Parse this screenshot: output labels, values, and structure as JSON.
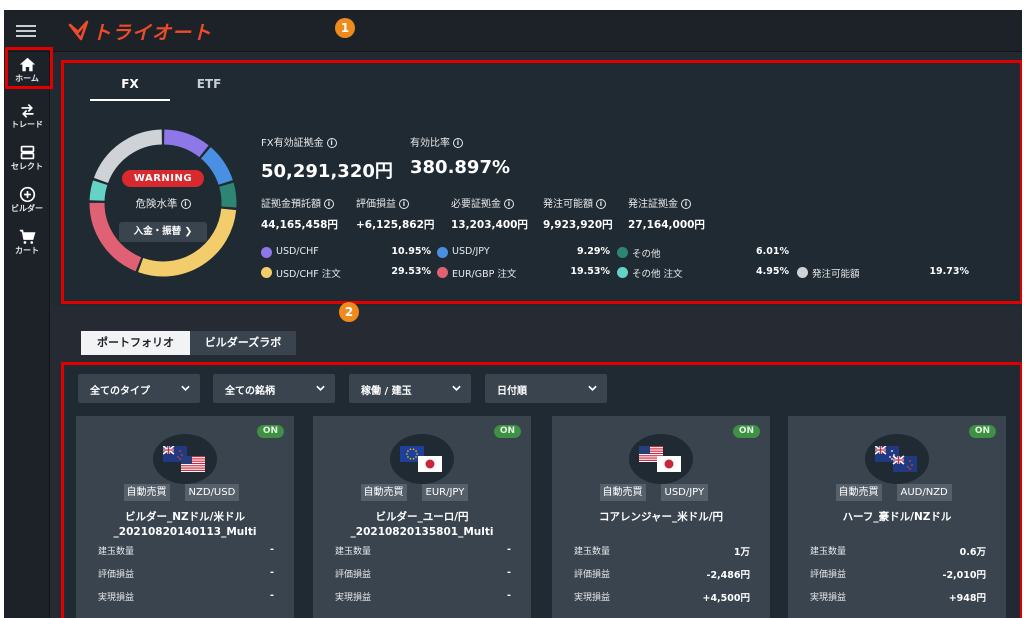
{
  "header": {
    "logo_text": "トライオート",
    "badge1": "1",
    "badge2": "2"
  },
  "sidebar": {
    "items": [
      {
        "label": "ホーム",
        "icon": "home-icon"
      },
      {
        "label": "トレード",
        "icon": "trade-arrows-icon"
      },
      {
        "label": "セレクト",
        "icon": "select-icon"
      },
      {
        "label": "ビルダー",
        "icon": "plus-circle-icon"
      },
      {
        "label": "カート",
        "icon": "cart-icon"
      }
    ]
  },
  "summary": {
    "tabs": {
      "fx": "FX",
      "etf": "ETF"
    },
    "warning": "WARNING",
    "risk_label": "危険水準",
    "deposit_button": "入金・振替",
    "fx_margin_label": "FX有効証拠金",
    "fx_margin_value": "50,291,320円",
    "ratio_label": "有効比率",
    "ratio_value": "380.897%",
    "metrics": [
      {
        "label": "証拠金預託額",
        "value": "44,165,458円"
      },
      {
        "label": "評価損益",
        "value": "+6,125,862円"
      },
      {
        "label": "必要証拠金",
        "value": "13,203,400円"
      },
      {
        "label": "発注可能額",
        "value": "9,923,920円"
      },
      {
        "label": "発注証拠金",
        "value": "27,164,000円"
      }
    ],
    "legend": [
      {
        "label": "USD/CHF",
        "pct": "10.95%",
        "color": "#8e78e8"
      },
      {
        "label": "USD/JPY",
        "pct": "9.29%",
        "color": "#4a90e2"
      },
      {
        "label": "その他",
        "pct": "6.01%",
        "color": "#2e8573"
      },
      {
        "label": "USD/CHF 注文",
        "pct": "29.53%",
        "color": "#f3cd6c"
      },
      {
        "label": "EUR/GBP 注文",
        "pct": "19.53%",
        "color": "#e06173"
      },
      {
        "label": "その他 注文",
        "pct": "4.95%",
        "color": "#64d3c6"
      },
      {
        "label": "発注可能額",
        "pct": "19.73%",
        "color": "#cfd2d6"
      }
    ]
  },
  "lower": {
    "tabs": {
      "portfolio": "ポートフォリオ",
      "builder_lab": "ビルダーズラボ"
    },
    "filters": [
      "全てのタイプ",
      "全ての銘柄",
      "稼働 / 建玉",
      "日付順"
    ],
    "row_labels": {
      "position": "建玉数量",
      "unrealized": "評価損益",
      "realized": "実現損益"
    },
    "cards": [
      {
        "status": "ON",
        "type": "自動売買",
        "pair": "NZD/USD",
        "name1": "ビルダー_NZドル/米ドル",
        "name2": "_20210820140113_Multi",
        "position": "-",
        "unrealized": "-",
        "realized": "-"
      },
      {
        "status": "ON",
        "type": "自動売買",
        "pair": "EUR/JPY",
        "name1": "ビルダー_ユーロ/円",
        "name2": "_20210820135801_Multi",
        "position": "-",
        "unrealized": "-",
        "realized": "-"
      },
      {
        "status": "ON",
        "type": "自動売買",
        "pair": "USD/JPY",
        "name1": "コアレンジャー_米ドル/円",
        "name2": "",
        "position": "1万",
        "unrealized": "-2,486円",
        "realized": "+4,500円"
      },
      {
        "status": "ON",
        "type": "自動売買",
        "pair": "AUD/NZD",
        "name1": "ハーフ_豪ドル/NZドル",
        "name2": "",
        "position": "0.6万",
        "unrealized": "-2,010円",
        "realized": "+948円"
      }
    ]
  },
  "chart_data": {
    "type": "pie",
    "categories": [
      "USD/CHF",
      "USD/JPY",
      "その他",
      "USD/CHF 注文",
      "EUR/GBP 注文",
      "その他 注文",
      "発注可能額"
    ],
    "values": [
      10.95,
      9.29,
      6.01,
      29.53,
      19.53,
      4.95,
      19.73
    ],
    "colors": [
      "#8e78e8",
      "#4a90e2",
      "#2e8573",
      "#f3cd6c",
      "#e06173",
      "#64d3c6",
      "#cfd2d6"
    ]
  }
}
